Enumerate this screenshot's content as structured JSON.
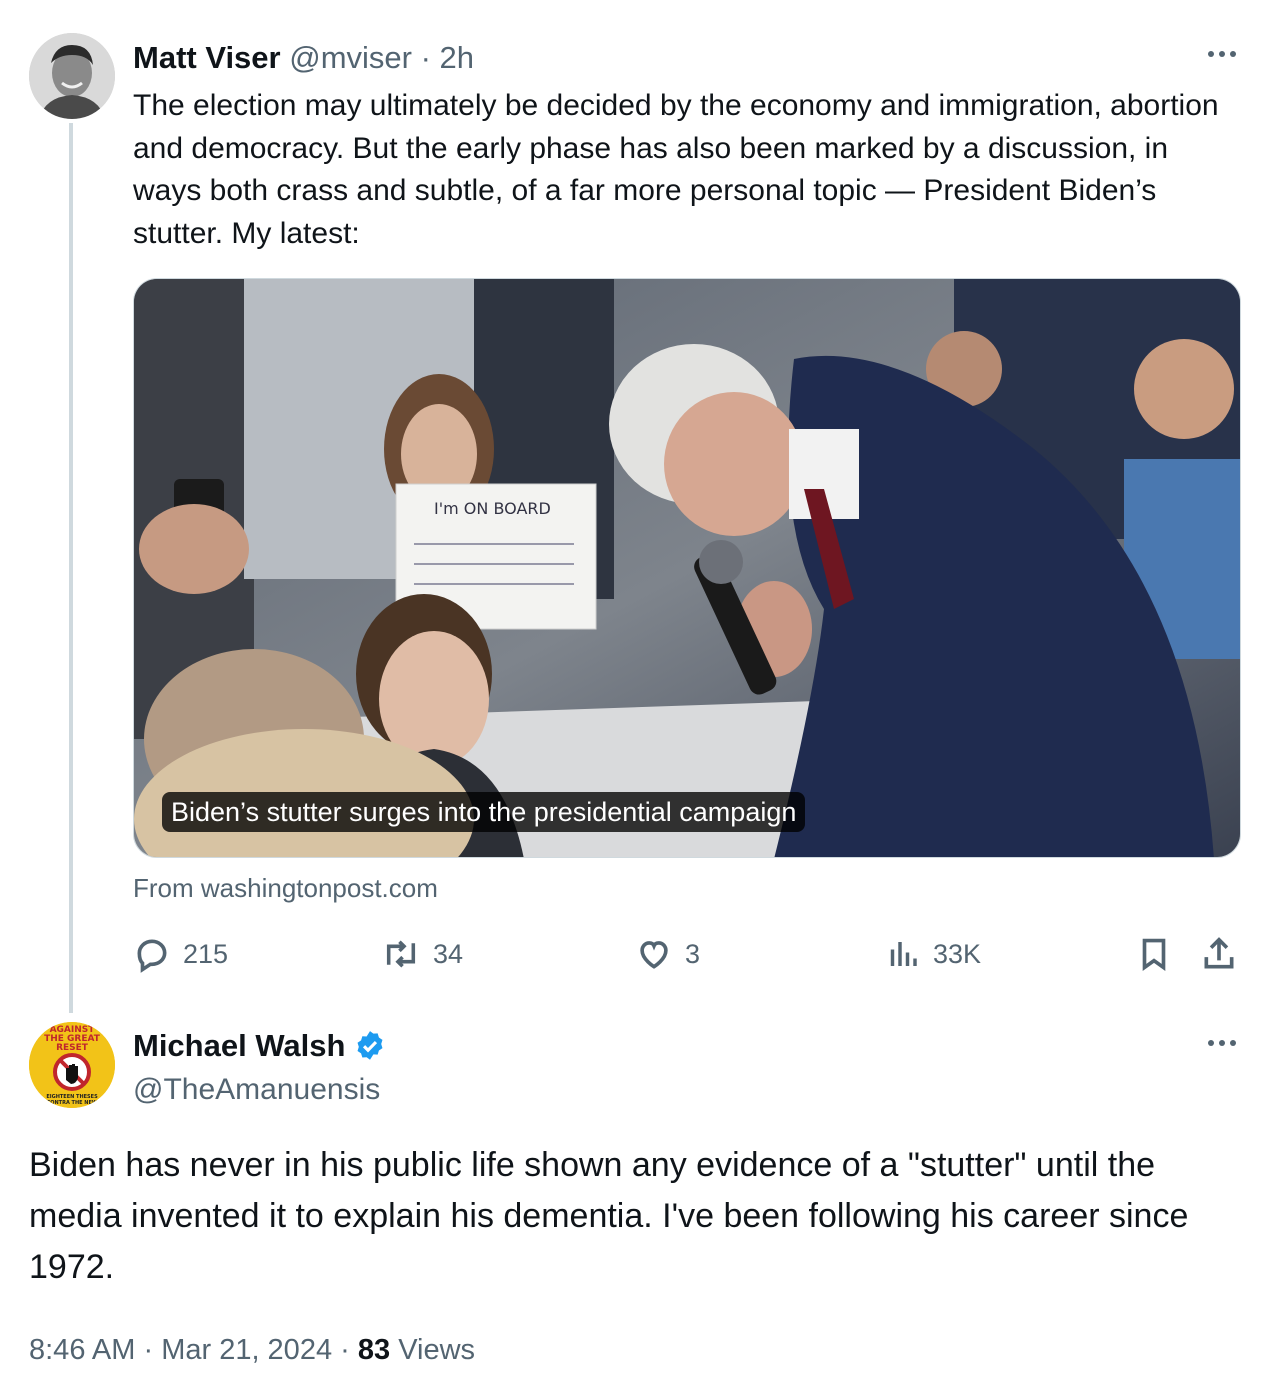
{
  "tweet1": {
    "author_name": "Matt Viser",
    "handle": "@mviser",
    "time": "2h",
    "text": "The election may ultimately be decided by the economy and immigration, abortion and democracy. But the early phase has also been marked by a discussion, in ways both crass and subtle, of a far more personal topic — President Biden’s stutter. My latest:",
    "card": {
      "caption": "Biden’s stutter surges into the presidential campaign",
      "source": "From washingtonpost.com"
    },
    "stats": {
      "replies": "215",
      "reposts": "34",
      "likes": "3",
      "views": "33K"
    }
  },
  "tweet2": {
    "author_name": "Michael Walsh",
    "handle": "@TheAmanuensis",
    "verified": true,
    "text": "Biden has never in his public life shown any evidence of a \"stutter\" until the media invented it to explain his dementia. I've been following his career since 1972.",
    "time": "8:46 AM",
    "date": "Mar 21, 2024",
    "views_count": "83",
    "views_label": "Views"
  },
  "avatar2_art": {
    "line1": "AGAINST",
    "line2": "THE GREAT",
    "line3": "RESET",
    "line4": "EIGHTEEN THESES",
    "line5": "CONTRA THE NEW"
  },
  "colors": {
    "text_primary": "#0f1419",
    "text_secondary": "#536471",
    "verified_blue": "#1d9bf0",
    "thread_line": "#cfd9de"
  },
  "icons": [
    "more-icon",
    "reply-icon",
    "repost-icon",
    "like-icon",
    "views-icon",
    "bookmark-icon",
    "share-icon",
    "verified-badge-icon"
  ]
}
